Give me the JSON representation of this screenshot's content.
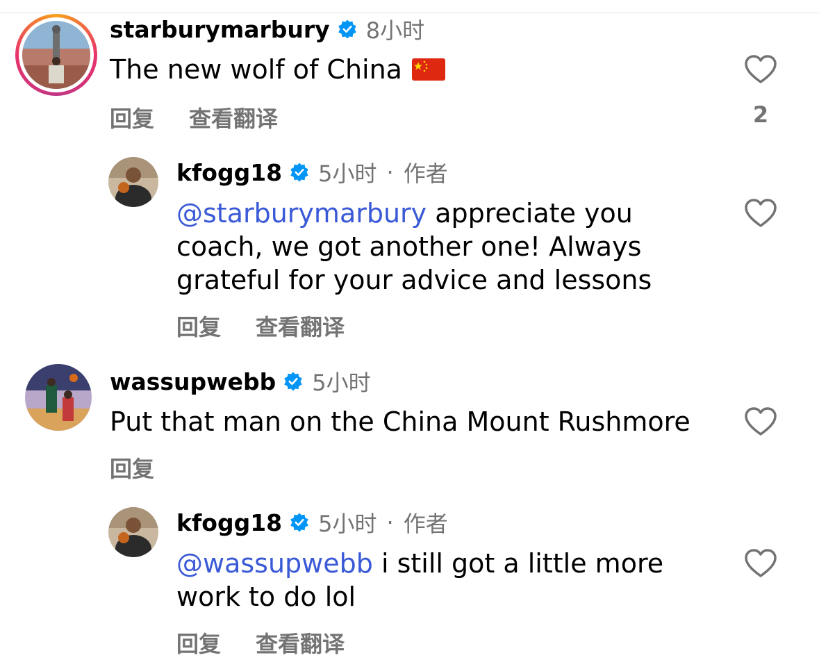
{
  "comments": [
    {
      "username": "starburymarbury",
      "time": "8小时",
      "text": "The new wolf of China",
      "emoji_icon": "china-flag-icon",
      "reply_label": "回复",
      "translate_label": "查看翻译",
      "like_count": "2"
    },
    {
      "username": "kfogg18",
      "time": "5小时",
      "separator": "·",
      "author_tag": "作者",
      "mention": "@starburymarbury",
      "text_line1": " appreciate you",
      "text_line2": "coach, we got another one! Always",
      "text_line3": "grateful for your advice and lessons",
      "reply_label": "回复",
      "translate_label": "查看翻译"
    },
    {
      "username": "wassupwebb",
      "time": "5小时",
      "text": "Put that man on the China Mount Rushmore",
      "reply_label": "回复"
    },
    {
      "username": "kfogg18",
      "time": "5小时",
      "separator": "·",
      "author_tag": "作者",
      "mention": "@wassupwebb",
      "text_line1": " i still got a little more",
      "text_line2": "work to do lol",
      "reply_label": "回复",
      "translate_label": "查看翻译"
    }
  ],
  "colors": {
    "mention": "#3a59d6",
    "meta": "#737373",
    "verified": "#0095f6"
  }
}
